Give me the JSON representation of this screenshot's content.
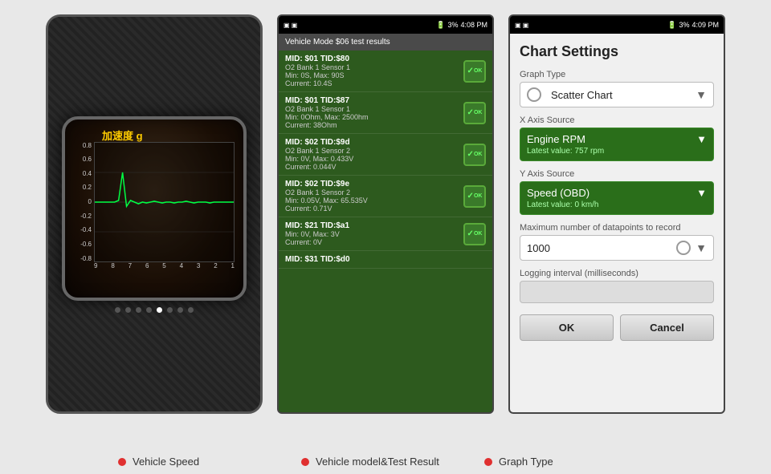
{
  "screen1": {
    "title": "加速度 g",
    "y_labels": [
      "0.8",
      "0.6",
      "0.4",
      "0.2",
      "0",
      "-0.2",
      "-0.4",
      "-0.6",
      "-0.8"
    ],
    "x_labels": [
      "9",
      "8",
      "7",
      "6",
      "5",
      "4",
      "3",
      "2",
      "1"
    ],
    "dots": [
      false,
      false,
      false,
      false,
      false,
      true,
      false,
      false
    ]
  },
  "screen2": {
    "status_bar_time": "4:08 PM",
    "battery": "3%",
    "header": "Vehicle Mode $06 test results",
    "items": [
      {
        "mid": "MID: $01 TID:$80",
        "sensor": "O2 Bank 1 Sensor 1",
        "min_max": "Min: 0S, Max: 90S",
        "current": "Current: 10.4S",
        "ok": true
      },
      {
        "mid": "MID: $01 TID:$87",
        "sensor": "O2 Bank 1 Sensor 1",
        "min_max": "Min: 0Ohm, Max: 2500hm",
        "current": "Current: 38Ohm",
        "ok": true
      },
      {
        "mid": "MID: $02 TID:$9d",
        "sensor": "O2 Bank 1 Sensor 2",
        "min_max": "Min: 0V, Max: 0.433V",
        "current": "Current: 0.044V",
        "ok": true
      },
      {
        "mid": "MID: $02 TID:$9e",
        "sensor": "O2 Bank 1 Sensor 2",
        "min_max": "Min: 0.05V, Max: 65.535V",
        "current": "Current: 0.71V",
        "ok": true
      },
      {
        "mid": "MID: $21 TID:$a1",
        "sensor": "",
        "min_max": "Min: 0V, Max: 3V",
        "current": "Current: 0V",
        "ok": true
      },
      {
        "mid": "MID: $31 TID:$d0",
        "sensor": "",
        "min_max": "",
        "current": "",
        "ok": false
      }
    ]
  },
  "screen3": {
    "status_bar_time": "4:09 PM",
    "battery": "3%",
    "title": "Chart Settings",
    "graph_type_label": "Graph Type",
    "graph_type_value": "Scatter Chart",
    "x_axis_label": "X Axis Source",
    "x_axis_value": "Engine RPM",
    "x_axis_sub": "Latest value: 757 rpm",
    "y_axis_label": "Y Axis Source",
    "y_axis_value": "Speed (OBD)",
    "y_axis_sub": "Latest value: 0 km/h",
    "max_datapoints_label": "Maximum number of datapoints to record",
    "max_datapoints_value": "1000",
    "logging_label": "Logging interval (milliseconds)",
    "btn_ok": "OK",
    "btn_cancel": "Cancel"
  },
  "labels": [
    {
      "text": "Vehicle Speed"
    },
    {
      "text": "Vehicle model&Test Result"
    },
    {
      "text": "Graph Type"
    }
  ]
}
